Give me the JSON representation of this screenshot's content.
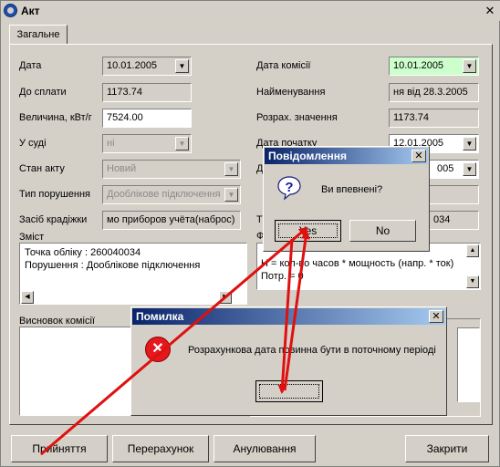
{
  "window": {
    "title": "Акт",
    "close_glyph": "✕"
  },
  "tab": {
    "label": "Загальне"
  },
  "left_fields": {
    "date": {
      "label": "Дата",
      "value": "10.01.2005"
    },
    "to_pay": {
      "label": "До сплати",
      "value": "1173.74"
    },
    "amount": {
      "label": "Величина, кВт/г",
      "value": "7524.00"
    },
    "court": {
      "label": "У суді",
      "value": "ні"
    },
    "act_state": {
      "label": "Стан акту",
      "value": "Новий"
    },
    "violation_type": {
      "label": "Тип порушення",
      "value": "Дооблікове підключення"
    },
    "theft_means": {
      "label": "Засіб крадіжки",
      "value": "мо приборов учёта(наброс)"
    }
  },
  "right_fields": {
    "commission_date": {
      "label": "Дата комісії",
      "value": "10.01.2005"
    },
    "name": {
      "label": "Найменування",
      "value": "ня від 28.3.2005"
    },
    "calc_value": {
      "label": "Розрах. значення",
      "value": "1173.74"
    },
    "start_date": {
      "label": "Дата початку",
      "value": "12.01.2005"
    },
    "end_date_value": "005",
    "row_d_label": "Д",
    "row_t_label": "Т",
    "row_t_value": "034",
    "row_f_label": "Ф"
  },
  "content": {
    "label": "Зміст",
    "lines": [
      "Точка обліку : 260040034",
      "Порушення : Дооблікове підключення"
    ]
  },
  "formula": {
    "lines": [
      "Н = кол-во часов * мощность (напр. * ток)",
      "Потр. = 0"
    ]
  },
  "conclusion": {
    "label": "Висновок комісії"
  },
  "buttons": {
    "accept": "Прийняття",
    "recalc": "Перерахунок",
    "cancel": "Анулювання",
    "close": "Закрити"
  },
  "confirm_dialog": {
    "title": "Повідомлення",
    "message": "Ви впевнені?",
    "yes": "Yes",
    "no": "No",
    "close_glyph": "✕",
    "icon_glyph": "?"
  },
  "error_dialog": {
    "title": "Помилка",
    "message": "Розрахункова дата повинна бути в поточному періоді",
    "ok": "",
    "close_glyph": "✕",
    "icon_glyph": "✕"
  },
  "annotation_colors": {
    "arrow": "#e01010"
  }
}
